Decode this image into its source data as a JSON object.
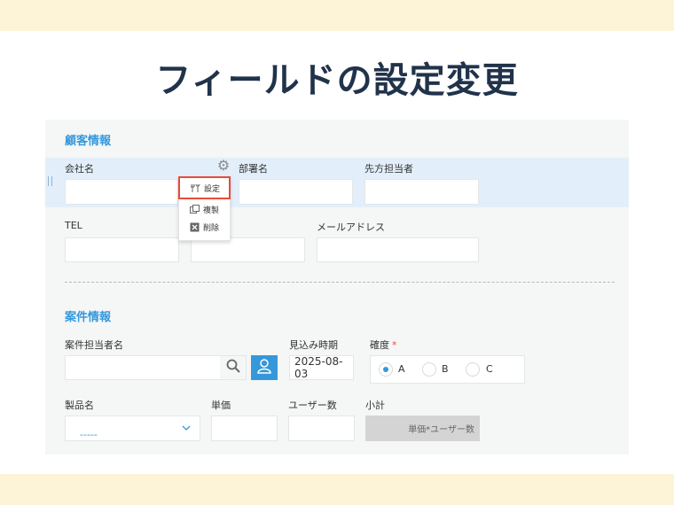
{
  "page": {
    "title": "フィールドの設定変更"
  },
  "colors": {
    "accent": "#3498db",
    "highlight": "#e2effa",
    "alert": "#e74c3c",
    "band": "#fdf4d8",
    "title": "#21334b"
  },
  "customer_section": {
    "title": "顧客情報",
    "fields": {
      "company": {
        "label": "会社名",
        "value": ""
      },
      "department": {
        "label": "部署名",
        "value": ""
      },
      "contact": {
        "label": "先方担当者",
        "value": ""
      },
      "tel": {
        "label": "TEL",
        "value": ""
      },
      "fax": {
        "label": "",
        "value": ""
      },
      "email": {
        "label": "メールアドレス",
        "value": ""
      }
    }
  },
  "field_menu": {
    "gear_icon": "gear-icon",
    "items": [
      {
        "label": "設定",
        "icon": "settings-tools-icon",
        "highlighted": true
      },
      {
        "label": "複製",
        "icon": "duplicate-icon"
      },
      {
        "label": "削除",
        "icon": "delete-icon"
      }
    ]
  },
  "deal_section": {
    "title": "案件情報",
    "fields": {
      "owner": {
        "label": "案件担当者名",
        "value": "",
        "search_icon": "search-icon",
        "user_icon": "user-icon"
      },
      "expected": {
        "label": "見込み時期",
        "value": "2025-08-03"
      },
      "certainty": {
        "label": "確度",
        "required_mark": "*",
        "options": [
          "A",
          "B",
          "C"
        ],
        "selected": "A"
      },
      "product": {
        "label": "製品名",
        "value": "-----"
      },
      "unit_price": {
        "label": "単価",
        "value": ""
      },
      "users": {
        "label": "ユーザー数",
        "value": ""
      },
      "subtotal": {
        "label": "小計",
        "value": "単価*ユーザー数"
      }
    }
  }
}
